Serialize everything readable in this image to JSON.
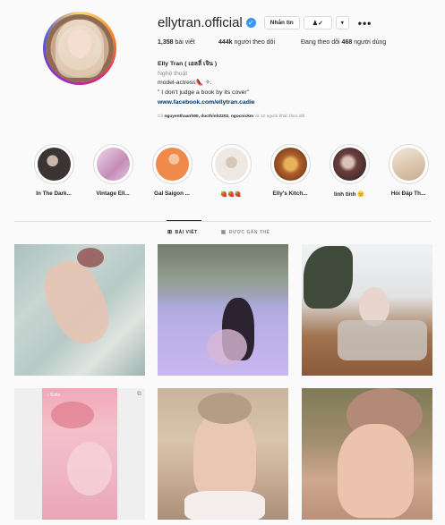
{
  "profile": {
    "username": "ellytran.official",
    "verified_glyph": "✓",
    "message_label": "Nhắn tin",
    "follow_glyph": "♟✓",
    "more_glyph": "▾",
    "options_glyph": "•••"
  },
  "stats": {
    "posts_count": "1,358",
    "posts_label": "bài viết",
    "followers_count": "444k",
    "followers_label": "người theo dõi",
    "following_prefix": "Đang theo dõi",
    "following_count": "468",
    "following_label": "người dùng"
  },
  "bio": {
    "name": "Elly Tran ( เอลลี่ เจิน )",
    "category": "Nghệ thuật",
    "line1": "model-actress👠 ✧.",
    "line2": "\" I don't judge a book by its cover\"",
    "link": "www.facebook.com/ellytran.cadie"
  },
  "followed_by": {
    "prefix": "Có",
    "names": "nguyenthaanh90, ducthinh2202, ngocnickm",
    "suffix": "và 10 người khác theo dõi"
  },
  "highlights": [
    {
      "label": "In The Dark...",
      "color": "#3a3432"
    },
    {
      "label": "Vintage Ell...",
      "color": "#d8a9c9"
    },
    {
      "label": "Gal Saigon ...",
      "color": "#f08a4b"
    },
    {
      "label": "🍓🍓🍓",
      "color": "#e9e2db"
    },
    {
      "label": "Elly's Kitch...",
      "color": "#b0602c"
    },
    {
      "label": "linh tinh 😐",
      "color": "#5a3a3a"
    },
    {
      "label": "Hỏi Đáp Th...",
      "color": "#e7d9c8"
    }
  ],
  "tabs": {
    "posts_icon": "⊞",
    "posts_label": "BÀI VIẾT",
    "tagged_icon": "▣",
    "tagged_label": "ĐƯỢC GẮN THẺ"
  },
  "posts": {
    "reel_label": "♪ Sofia",
    "reel_icon": "⧉"
  },
  "colors": {
    "accent": "#3897f0",
    "link": "#003569",
    "muted": "#8e8e8e",
    "border": "#dbdbdb"
  }
}
